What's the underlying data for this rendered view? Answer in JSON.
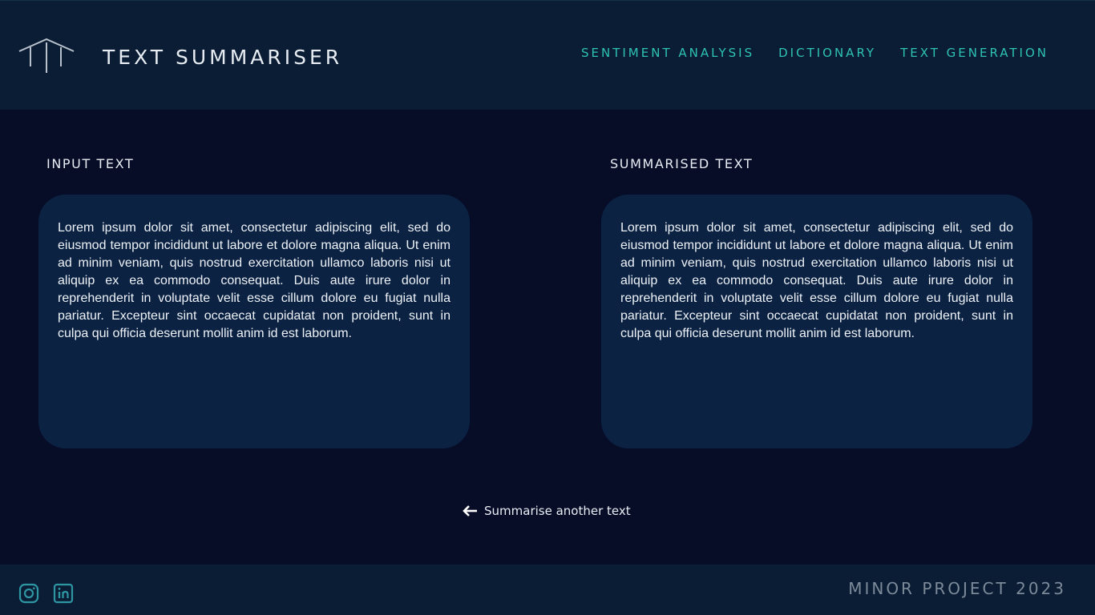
{
  "header": {
    "title": "TEXT SUMMARISER",
    "logo_icon": "pillars-logo-icon",
    "nav": [
      {
        "label": "SENTIMENT ANALYSIS"
      },
      {
        "label": "DICTIONARY"
      },
      {
        "label": "TEXT GENERATION"
      }
    ]
  },
  "input_panel": {
    "heading": "INPUT TEXT",
    "text": "Lorem ipsum dolor sit amet, consectetur adipiscing elit, sed do eiusmod tempor incididunt ut labore et dolore magna aliqua. Ut enim ad minim veniam, quis nostrud exercitation ullamco laboris nisi ut aliquip ex ea commodo consequat. Duis aute irure dolor in reprehenderit in voluptate velit esse cillum dolore eu fugiat nulla pariatur. Excepteur sint occaecat cupidatat non proident, sunt in culpa qui officia deserunt mollit anim id est laborum."
  },
  "output_panel": {
    "heading": "SUMMARISED TEXT",
    "text": "Lorem ipsum dolor sit amet, consectetur adipiscing elit, sed do eiusmod tempor incididunt ut labore et dolore magna aliqua. Ut enim ad minim veniam, quis nostrud exercitation ullamco laboris nisi ut aliquip ex ea commodo consequat. Duis aute irure dolor in reprehenderit in voluptate velit esse cillum dolore eu fugiat nulla pariatur. Excepteur sint occaecat cupidatat non proident, sunt in culpa qui officia deserunt mollit anim id est laborum."
  },
  "back_link": {
    "label": "Summarise another text",
    "icon": "arrow-left-icon"
  },
  "footer": {
    "text": "MINOR PROJECT 2023",
    "social": [
      "instagram-icon",
      "linkedin-icon"
    ]
  },
  "colors": {
    "background": "#070c27",
    "header_bg": "#0a1d35",
    "panel_bg": "#0b2243",
    "accent": "#2ec2b3",
    "footer_text": "#7d8a99"
  }
}
